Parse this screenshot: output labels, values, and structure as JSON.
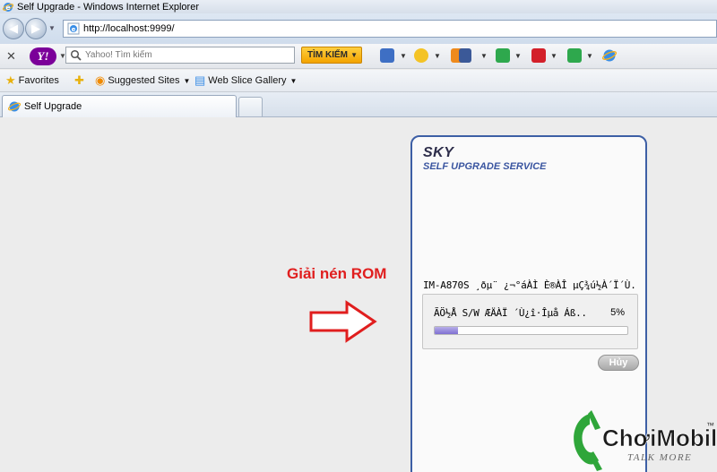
{
  "window": {
    "title": "Self Upgrade - Windows Internet Explorer"
  },
  "address": {
    "url": "http://localhost:9999/"
  },
  "yahoo_toolbar": {
    "search_placeholder": "Yahoo! Tìm kiếm",
    "search_button": "TÌM KIẾM"
  },
  "favorites_bar": {
    "favorites": "Favorites",
    "suggested_sites": "Suggested Sites",
    "web_slice_gallery": "Web Slice Gallery"
  },
  "tabs": [
    {
      "label": "Self Upgrade"
    }
  ],
  "annotation": {
    "text": "Giải nén ROM"
  },
  "upgrade_panel": {
    "brand": "SKY",
    "service": "SELF UPGRADE SERVICE",
    "message": "IM-A870S ¸ðµ¨ ¿¬°áÀÌ È®ÀÎ µÇ¾ú½À´Ï´Ù.",
    "progress_message": "ÃÖ½Å S/W ÆÄÀÏ ´Ù¿î·Îµå Áß..",
    "progress_percent_label": "5%",
    "progress": 0.05,
    "cancel_button": "Hủy"
  },
  "watermark": {
    "brand": "ChơiMobile",
    "slogan": "TALK MORE",
    "trademark": "™"
  },
  "colors": {
    "annotation_red": "#e01e1e",
    "panel_border": "#3d5fa5",
    "progress_fill": "#7e6fd2",
    "yahoo_purple": "#7b0099",
    "search_button": "#f3a300"
  }
}
